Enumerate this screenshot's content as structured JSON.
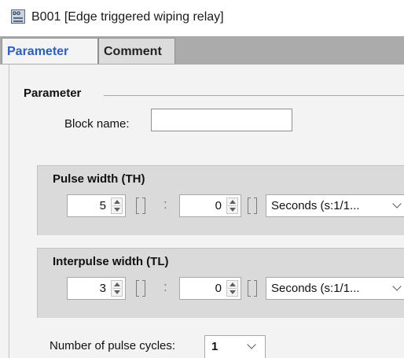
{
  "window": {
    "title": "B001 [Edge triggered wiping relay]",
    "icon": "function-block-icon"
  },
  "tabs": [
    {
      "label": "Parameter",
      "active": true
    },
    {
      "label": "Comment",
      "active": false
    }
  ],
  "parameter_section": {
    "title": "Parameter",
    "block_name_label": "Block name:",
    "block_name_value": ""
  },
  "pulse_width": {
    "title": "Pulse width (TH)",
    "value_1": "5",
    "separator": ":",
    "value_2": "0",
    "unit": "Seconds (s:1/1..."
  },
  "interpulse_width": {
    "title": "Interpulse width (TL)",
    "value_1": "3",
    "separator": ":",
    "value_2": "0",
    "unit": "Seconds (s:1/1..."
  },
  "pulse_cycles": {
    "label": "Number of pulse cycles:",
    "value": "1"
  },
  "colors": {
    "active_tab_text": "#2a5ec7",
    "tabstrip": "#ababab",
    "panel": "#f3f3f3",
    "group": "#dadada"
  }
}
